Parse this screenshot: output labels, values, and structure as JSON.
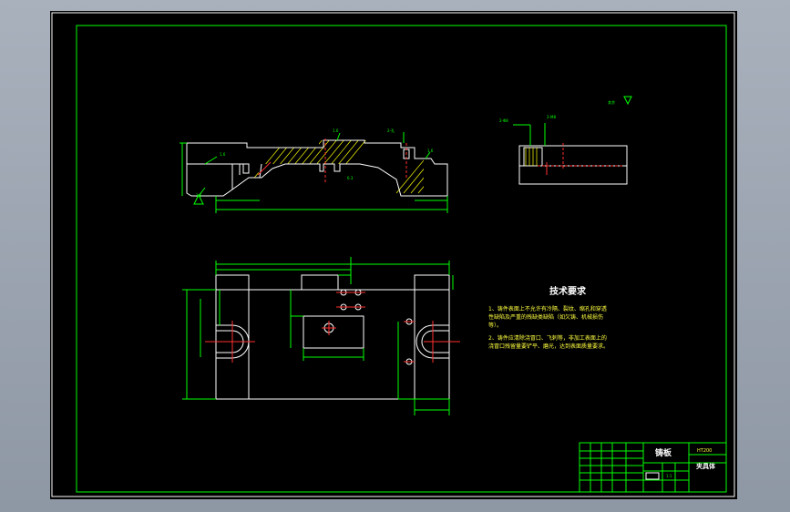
{
  "notes": {
    "title": "技术要求",
    "line1": "1、铸件表面上不允许有冷隔、裂纹、缩孔和穿透",
    "line2": "性缺陷及严重的残缺类缺陷（如欠铸、机械损伤",
    "line3": "等）。",
    "line4": "2、铸件应清除浇冒口、飞刺等，非加工表面上的",
    "line5": "浇冒口残留量要铲平、磨光，达到表面质量要求。"
  },
  "surface_note": "其余",
  "callouts": {
    "left_top": "1.6",
    "left_bottom": "1.6",
    "mid_top": "1.6",
    "mid_bottom": "6.3",
    "hole": "2-孔",
    "right_top": "1.6",
    "side_a": "2-Φ8",
    "side_b": "2-M8"
  },
  "title_block": {
    "part_name": "铸板",
    "material": "HT200",
    "school": "夹具体",
    "scale": "1:1"
  }
}
